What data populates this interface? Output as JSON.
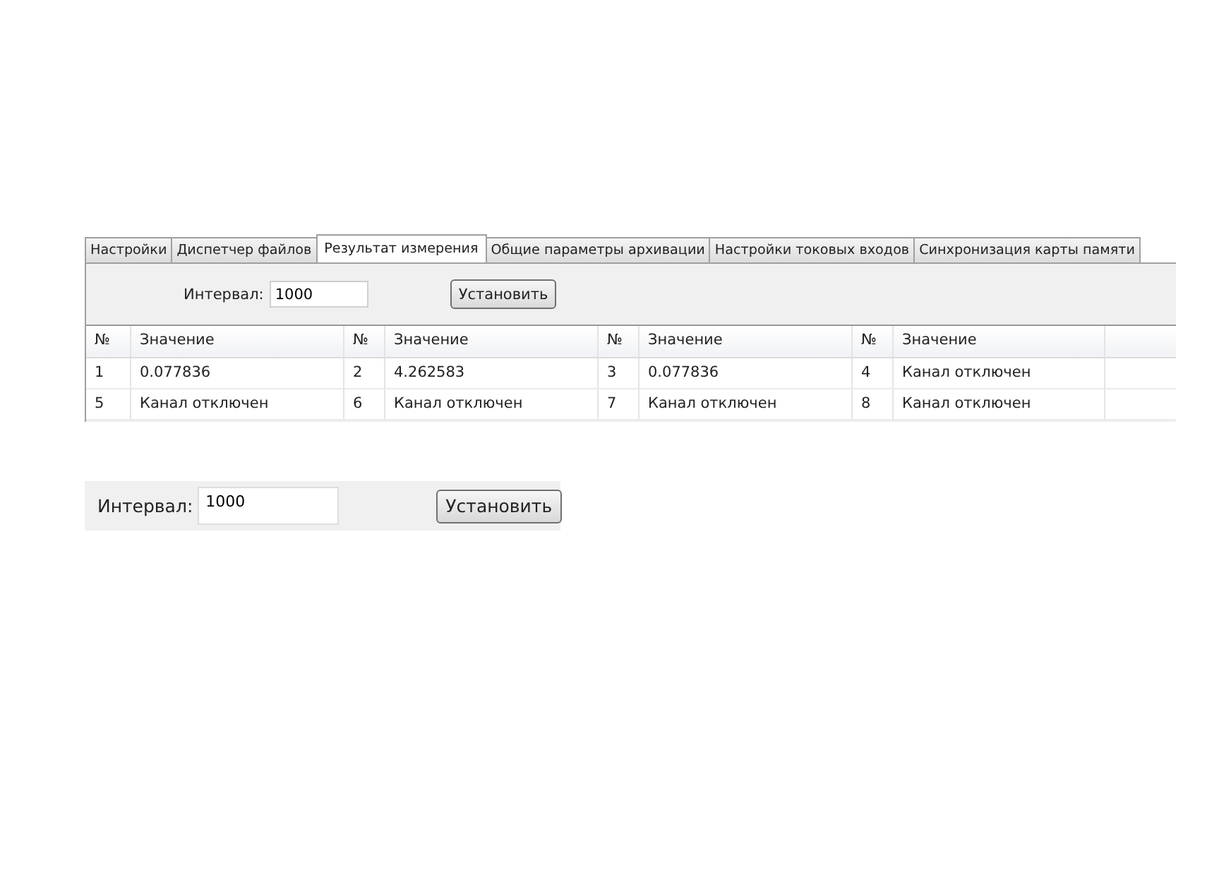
{
  "tabs": [
    {
      "label": "Настройки",
      "selected": false
    },
    {
      "label": "Диспетчер файлов",
      "selected": false
    },
    {
      "label": "Результат измерения",
      "selected": true
    },
    {
      "label": "Общие параметры архивации",
      "selected": false
    },
    {
      "label": "Настройки токовых входов",
      "selected": false
    },
    {
      "label": "Синхронизация карты памяти",
      "selected": false
    }
  ],
  "interval": {
    "label": "Интервал:",
    "value": "1000",
    "button": "Установить"
  },
  "table": {
    "columns": [
      "№",
      "Значение",
      "№",
      "Значение",
      "№",
      "Значение",
      "№",
      "Значение"
    ],
    "rows": [
      [
        "1",
        "0.077836",
        "2",
        "4.262583",
        "3",
        "0.077836",
        "4",
        "Канал отключен"
      ],
      [
        "5",
        "Канал отключен",
        "6",
        "Канал отключен",
        "7",
        "Канал отключен",
        "8",
        "Канал отключен"
      ]
    ]
  },
  "enlarged_interval": {
    "label": "Интервал:",
    "value": "1000",
    "button": "Установить"
  }
}
